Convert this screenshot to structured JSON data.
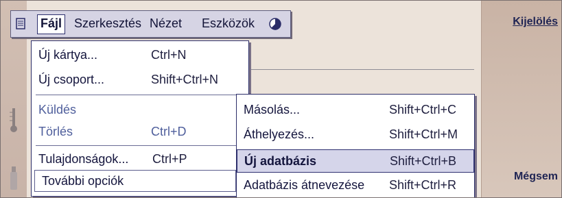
{
  "menubar": {
    "items": [
      {
        "label": "Fájl",
        "active": true
      },
      {
        "label": "Szerkesztés"
      },
      {
        "label": "Nézet"
      },
      {
        "label": "Eszközök"
      }
    ]
  },
  "file_menu": {
    "items": [
      {
        "label": "Új kártya...",
        "shortcut": "Ctrl+N"
      },
      {
        "label": "Új csoport...",
        "shortcut": "Shift+Ctrl+N"
      },
      {
        "label": "Küldés",
        "shortcut": ""
      },
      {
        "label": "Törlés",
        "shortcut": "Ctrl+D"
      },
      {
        "label": "Tulajdonságok...",
        "shortcut": "Ctrl+P"
      },
      {
        "label": "További opciók",
        "shortcut": ""
      }
    ]
  },
  "sub_menu": {
    "items": [
      {
        "label": "Másolás...",
        "shortcut": "Shift+Ctrl+C"
      },
      {
        "label": "Áthelyezés...",
        "shortcut": "Shift+Ctrl+M"
      },
      {
        "label": "Új adatbázis",
        "shortcut": "Shift+Ctrl+B"
      },
      {
        "label": "Adatbázis átnevezése",
        "shortcut": "Shift+Ctrl+R"
      }
    ]
  },
  "commands": {
    "select": "Kijelölés",
    "cancel": "Mégsem"
  },
  "icons": {
    "app_menu": "app-menu-icon",
    "clock": "clock-icon"
  },
  "colors": {
    "menu_text": "#14153d",
    "highlight_bg": "#d5d5ea",
    "border": "#2b2d68",
    "dim_text": "#4f5f9c"
  }
}
